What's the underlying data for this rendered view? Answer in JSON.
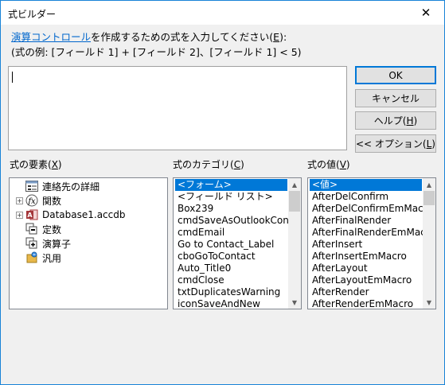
{
  "window": {
    "title": "式ビルダー",
    "close_glyph": "✕"
  },
  "instructions": {
    "link": "演算コントロール",
    "text": "を作成するための式を入力してください(",
    "hotkey": "E",
    "tail": "):",
    "example": "(式の例: [フィールド 1] + [フィールド 2]、[フィールド 1] < 5)"
  },
  "expression": {
    "value": ""
  },
  "buttons": {
    "ok": "OK",
    "cancel": "キャンセル",
    "help": "ヘルプ(",
    "help_key": "H",
    "help_tail": ")",
    "options": "<< オプション(",
    "options_key": "L",
    "options_tail": ")"
  },
  "elements": {
    "label": "式の要素(",
    "label_key": "X",
    "label_tail": ")",
    "items": [
      {
        "label": "連絡先の詳細",
        "icon": "form-icon",
        "expander": ""
      },
      {
        "label": "関数",
        "icon": "function-icon",
        "expander": "+"
      },
      {
        "label": "Database1.accdb",
        "icon": "access-database-icon",
        "expander": "+"
      },
      {
        "label": "定数",
        "icon": "constants-icon",
        "expander": ""
      },
      {
        "label": "演算子",
        "icon": "operators-icon",
        "expander": ""
      },
      {
        "label": "汎用",
        "icon": "common-expressions-icon",
        "expander": ""
      }
    ]
  },
  "categories": {
    "label": "式のカテゴリ(",
    "label_key": "C",
    "label_tail": ")",
    "items": [
      "<フォーム>",
      "<フィールド リスト>",
      "Box239",
      "cmdSaveAsOutlookCont",
      "cmdEmail",
      "Go to Contact_Label",
      "cboGoToContact",
      "Auto_Title0",
      "cmdClose",
      "txtDuplicatesWarning",
      "iconSaveAndNew"
    ],
    "selected_index": 0
  },
  "values": {
    "label": "式の値(",
    "label_key": "V",
    "label_tail": ")",
    "items": [
      "<値>",
      "AfterDelConfirm",
      "AfterDelConfirmEmMacr",
      "AfterFinalRender",
      "AfterFinalRenderEmMac",
      "AfterInsert",
      "AfterInsertEmMacro",
      "AfterLayout",
      "AfterLayoutEmMacro",
      "AfterRender",
      "AfterRenderEmMacro"
    ],
    "selected_index": 0
  },
  "colors": {
    "accent": "#0078d7",
    "link": "#0066cc",
    "border": "#1883d7"
  }
}
